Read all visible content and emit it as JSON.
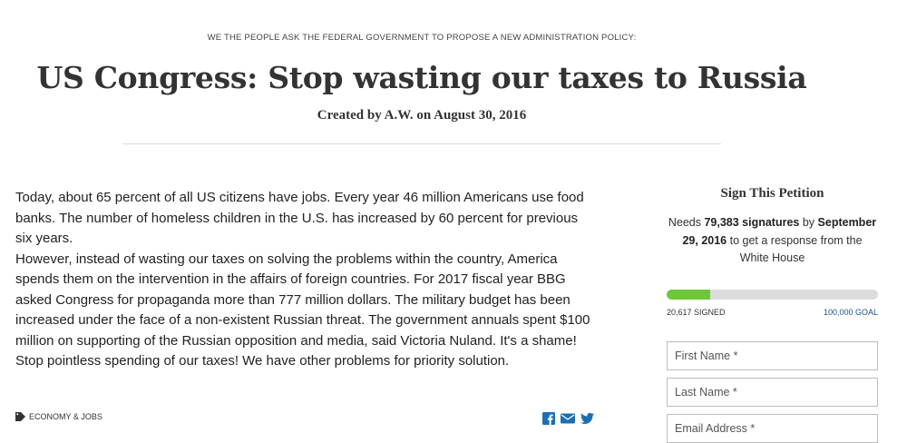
{
  "header": {
    "kicker": "WE THE PEOPLE ASK THE FEDERAL GOVERNMENT TO PROPOSE A NEW ADMINISTRATION POLICY:",
    "title": "US Congress: Stop wasting our taxes to Russia",
    "byline": "Created by A.W. on August 30, 2016"
  },
  "petition": {
    "paragraphs": [
      "Today, about 65 percent of all US citizens have jobs. Every year 46 million Americans use food banks. The number of homeless children in the U.S. has increased by 60 percent for previous six years.",
      "However, instead of wasting our taxes on solving the problems within the country, America spends them on the intervention in the affairs of foreign countries. For 2017 fiscal year BBG asked Congress for propaganda more than 777 million dollars. The military budget has been increased under the face of a non-existent Russian threat. The government annuals spent $100 million on supporting of the Russian opposition and media, said Victoria Nuland. It's a shame! Stop pointless spending of our taxes! We have other problems for priority solution."
    ],
    "tag": "ECONOMY & JOBS",
    "share_icons": [
      "facebook-icon",
      "email-icon",
      "twitter-icon"
    ]
  },
  "sidebar": {
    "title": "Sign This Petition",
    "needs_prefix": "Needs ",
    "needs_count": "79,383 signatures",
    "needs_mid": " by ",
    "needs_date": "September 29, 2016",
    "needs_suffix": " to get a response from the White House",
    "signed_label": "20,617 SIGNED",
    "goal_label": "100,000 GOAL",
    "progress_fraction": 0.20617,
    "fields": {
      "first_name": "First Name *",
      "last_name": "Last Name *",
      "email": "Email Address *"
    }
  },
  "colors": {
    "progress_fill": "#6ec738",
    "progress_track": "#dcdcdc",
    "link_blue": "#1b4f8c",
    "share_blue": "#1b6fb5"
  }
}
